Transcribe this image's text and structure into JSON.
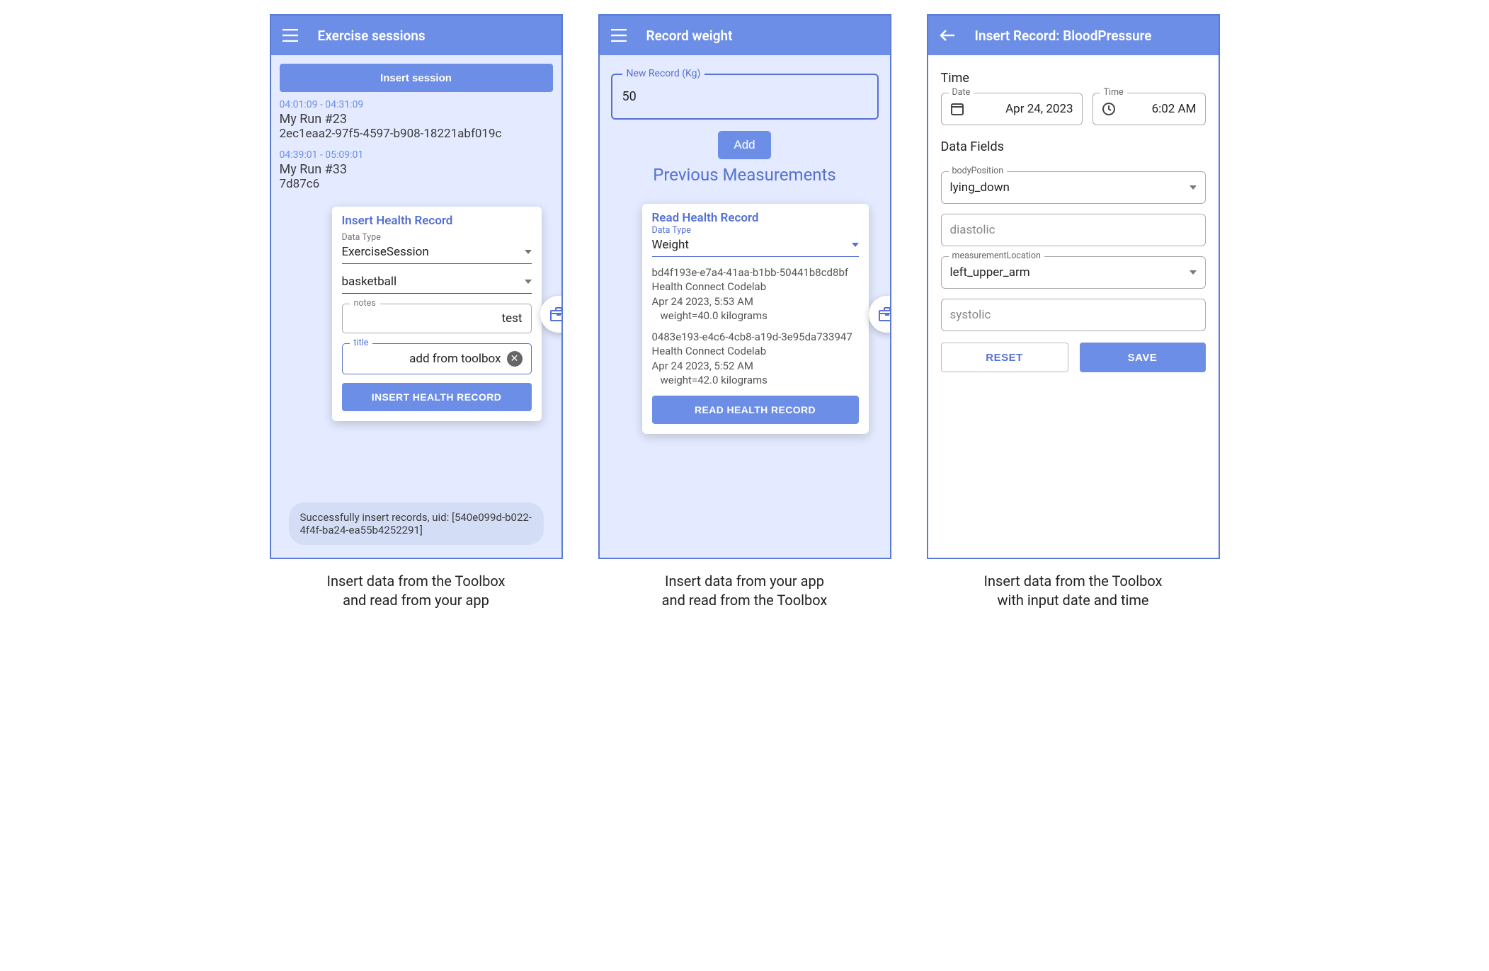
{
  "screen1": {
    "appbar_title": "Exercise sessions",
    "insert_session_btn": "Insert session",
    "sessions": [
      {
        "time": "04:01:09 - 04:31:09",
        "title": "My Run #23",
        "uid": "2ec1eaa2-97f5-4597-b908-18221abf019c"
      },
      {
        "time": "04:39:01 - 05:09:01",
        "title": "My Run #33",
        "uid": "7d87c6"
      }
    ],
    "popup": {
      "title": "Insert Health Record",
      "data_type_label": "Data Type",
      "data_type_value": "ExerciseSession",
      "exercise_type_value": "basketball",
      "notes_label": "notes",
      "notes_value": "test",
      "title_label": "title",
      "title_value": "add from toolbox",
      "button": "INSERT HEALTH RECORD"
    },
    "toast": "Successfully insert records, uid: [540e099d-b022-4f4f-ba24-ea55b4252291]",
    "caption_line1": "Insert data from the Toolbox",
    "caption_line2": "and read from your app"
  },
  "screen2": {
    "appbar_title": "Record weight",
    "input_label": "New Record (Kg)",
    "input_value": "50",
    "add_btn": "Add",
    "prev_title": "Previous Measurements",
    "popup": {
      "title": "Read Health Record",
      "data_type_label": "Data Type",
      "data_type_value": "Weight",
      "records": [
        {
          "uid": "bd4f193e-e7a4-41aa-b1bb-50441b8cd8bf",
          "app": "Health Connect Codelab",
          "time": "Apr 24 2023, 5:53 AM",
          "value": "weight=40.0 kilograms"
        },
        {
          "uid": "0483e193-e4c6-4cb8-a19d-3e95da733947",
          "app": "Health Connect Codelab",
          "time": "Apr 24 2023, 5:52 AM",
          "value": "weight=42.0 kilograms"
        }
      ],
      "button": "READ HEALTH RECORD"
    },
    "caption_line1": "Insert data from your app",
    "caption_line2": "and read from the Toolbox"
  },
  "screen3": {
    "appbar_title": "Insert Record: BloodPressure",
    "time_section": "Time",
    "date_label": "Date",
    "date_value": "Apr 24, 2023",
    "time_label": "Time",
    "time_value": "6:02 AM",
    "fields_section": "Data Fields",
    "body_position_label": "bodyPosition",
    "body_position_value": "lying_down",
    "diastolic_label": "diastolic",
    "measurement_loc_label": "measurementLocation",
    "measurement_loc_value": "left_upper_arm",
    "systolic_label": "systolic",
    "reset_btn": "RESET",
    "save_btn": "SAVE",
    "caption_line1": "Insert data from the Toolbox",
    "caption_line2": "with input date and time"
  }
}
